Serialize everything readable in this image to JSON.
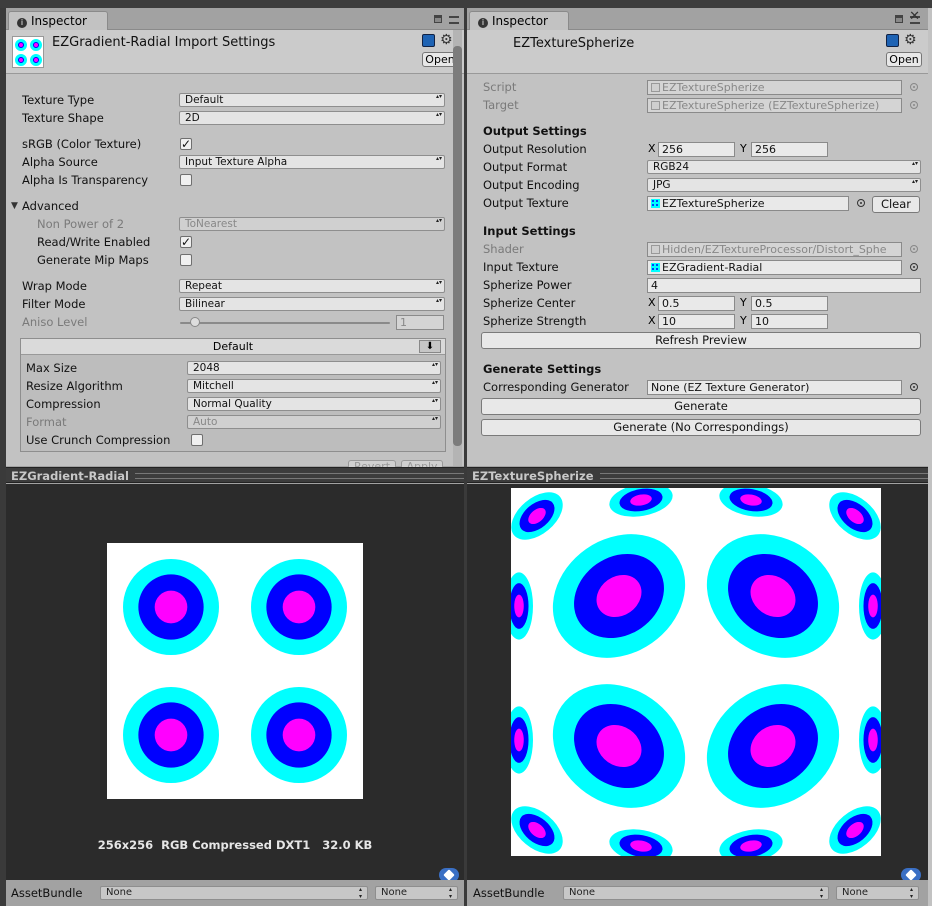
{
  "left": {
    "tab_label": "Inspector",
    "title": "EZGradient-Radial Import Settings",
    "open_label": "Open",
    "rows": {
      "texture_type": {
        "label": "Texture Type",
        "value": "Default"
      },
      "texture_shape": {
        "label": "Texture Shape",
        "value": "2D"
      },
      "srgb": {
        "label": "sRGB (Color Texture)",
        "checked": true
      },
      "alpha_source": {
        "label": "Alpha Source",
        "value": "Input Texture Alpha"
      },
      "alpha_transparency": {
        "label": "Alpha Is Transparency",
        "checked": false
      },
      "advanced": {
        "label": "Advanced"
      },
      "non_power_of_2": {
        "label": "Non Power of 2",
        "value": "ToNearest"
      },
      "read_write": {
        "label": "Read/Write Enabled",
        "checked": true
      },
      "mip_maps": {
        "label": "Generate Mip Maps",
        "checked": false
      },
      "wrap_mode": {
        "label": "Wrap Mode",
        "value": "Repeat"
      },
      "filter_mode": {
        "label": "Filter Mode",
        "value": "Bilinear"
      },
      "aniso_level": {
        "label": "Aniso Level",
        "value": "1"
      }
    },
    "platform": {
      "header": "Default",
      "max_size": {
        "label": "Max Size",
        "value": "2048"
      },
      "resize_algorithm": {
        "label": "Resize Algorithm",
        "value": "Mitchell"
      },
      "compression": {
        "label": "Compression",
        "value": "Normal Quality"
      },
      "format": {
        "label": "Format",
        "value": "Auto"
      },
      "crunch": {
        "label": "Use Crunch Compression",
        "checked": false
      }
    },
    "revert_label": "Revert",
    "apply_label": "Apply",
    "preview_title": "EZGradient-Radial",
    "preview_info": "256x256  RGB Compressed DXT1   32.0 KB",
    "footer_label": "AssetBundle",
    "footer_bundle": "None",
    "footer_variant": "None"
  },
  "right": {
    "tab_label": "Inspector",
    "title": "EZTextureSpherize",
    "open_label": "Open",
    "script": {
      "label": "Script",
      "value": "EZTextureSpherize"
    },
    "target": {
      "label": "Target",
      "value": "EZTextureSpherize (EZTextureSpherize)"
    },
    "output_settings": {
      "title": "Output Settings",
      "resolution": {
        "label": "Output Resolution",
        "x_label": "X",
        "x": "256",
        "y_label": "Y",
        "y": "256"
      },
      "format": {
        "label": "Output Format",
        "value": "RGB24"
      },
      "encoding": {
        "label": "Output Encoding",
        "value": "JPG"
      },
      "texture": {
        "label": "Output Texture",
        "value": "EZTextureSpherize",
        "clear_label": "Clear"
      }
    },
    "input_settings": {
      "title": "Input Settings",
      "shader": {
        "label": "Shader",
        "value": "Hidden/EZTextureProcessor/Distort_Sphe"
      },
      "input_texture": {
        "label": "Input Texture",
        "value": "EZGradient-Radial"
      },
      "power": {
        "label": "Spherize Power",
        "value": "4"
      },
      "center": {
        "label": "Spherize Center",
        "x_label": "X",
        "x": "0.5",
        "y_label": "Y",
        "y": "0.5"
      },
      "strength": {
        "label": "Spherize Strength",
        "x_label": "X",
        "x": "10",
        "y_label": "Y",
        "y": "10"
      },
      "refresh_label": "Refresh Preview"
    },
    "generate_settings": {
      "title": "Generate Settings",
      "generator": {
        "label": "Corresponding Generator",
        "value": "None (EZ Texture Generator)"
      },
      "generate_label": "Generate",
      "generate_no_corr_label": "Generate (No Correspondings)"
    },
    "preview_title": "EZTextureSpherize",
    "footer_label": "AssetBundle",
    "footer_bundle": "None",
    "footer_variant": "None"
  },
  "colors": {
    "ring_outer": "#00ffff",
    "ring_mid": "#0000ff",
    "ring_inner": "#ff00ff"
  }
}
